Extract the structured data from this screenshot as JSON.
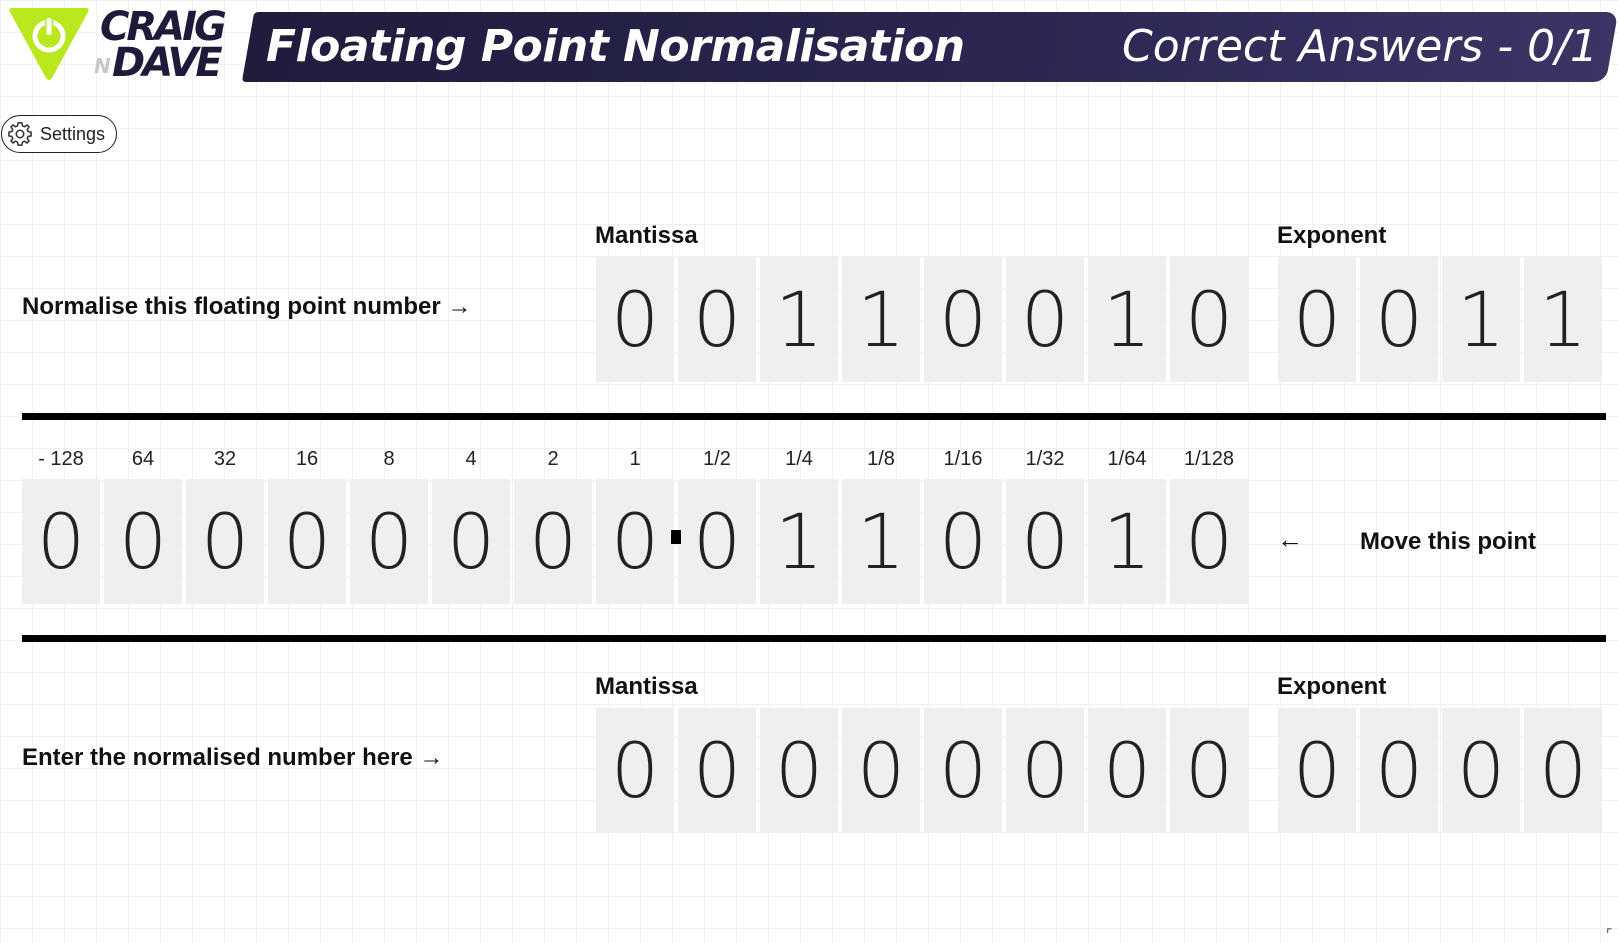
{
  "header": {
    "brand_line1": "CRAIG",
    "brand_n": "N",
    "brand_line2": "DAVE",
    "title": "Floating Point Normalisation",
    "score": "Correct Answers - 0/1",
    "accent_color": "#b9e81f",
    "banner_color": "#1f1c3c"
  },
  "settings": {
    "label": "Settings",
    "icon": "gear-icon"
  },
  "question": {
    "prompt": "Normalise this floating point number →",
    "mantissa_label": "Mantissa",
    "exponent_label": "Exponent",
    "mantissa_bits": [
      "0",
      "0",
      "1",
      "1",
      "0",
      "0",
      "1",
      "0"
    ],
    "exponent_bits": [
      "0",
      "0",
      "1",
      "1"
    ]
  },
  "working": {
    "place_values": [
      "- 128",
      "64",
      "32",
      "16",
      "8",
      "4",
      "2",
      "1",
      "1/2",
      "1/4",
      "1/8",
      "1/16",
      "1/32",
      "1/64",
      "1/128"
    ],
    "bits": [
      "0",
      "0",
      "0",
      "0",
      "0",
      "0",
      "0",
      "0",
      "0",
      "1",
      "1",
      "0",
      "0",
      "1",
      "0"
    ],
    "move_arrow": "←",
    "move_label": "Move this point"
  },
  "answer": {
    "prompt": "Enter the normalised number here →",
    "mantissa_label": "Mantissa",
    "exponent_label": "Exponent",
    "mantissa_bits": [
      "0",
      "0",
      "0",
      "0",
      "0",
      "0",
      "0",
      "0"
    ],
    "exponent_bits": [
      "0",
      "0",
      "0",
      "0"
    ]
  },
  "corner_glyph": "⌜"
}
